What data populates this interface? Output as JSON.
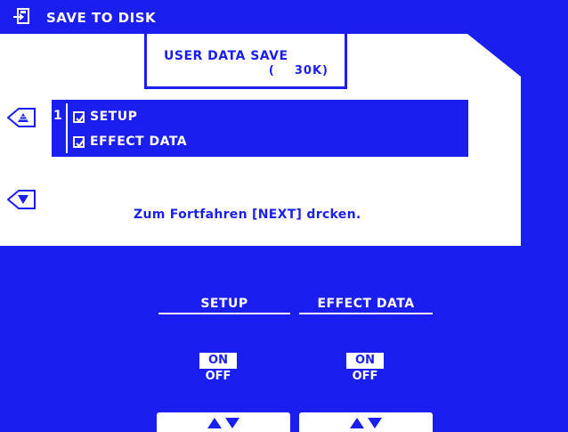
{
  "header": {
    "title": "SAVE TO DISK",
    "icon": "save-to-disk-icon"
  },
  "data_box": {
    "title": "USER DATA SAVE",
    "size": "(    30K)"
  },
  "list": {
    "number": "1",
    "items": [
      {
        "label": "SETUP",
        "checked": true
      },
      {
        "label": "EFFECT DATA",
        "checked": true
      }
    ]
  },
  "message": "Zum Fortfahren [NEXT] drcken.",
  "columns": [
    {
      "header": "SETUP",
      "on_label": "ON",
      "off_label": "OFF",
      "selected": "ON"
    },
    {
      "header": "EFFECT DATA",
      "on_label": "ON",
      "off_label": "OFF",
      "selected": "ON"
    }
  ],
  "colors": {
    "background": "#1a1ff0",
    "panel": "#ffffff"
  }
}
